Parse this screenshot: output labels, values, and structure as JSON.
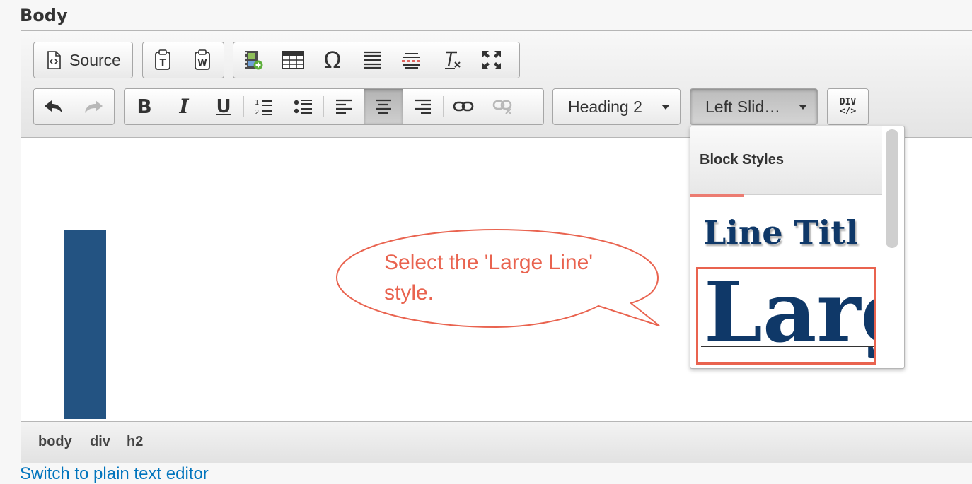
{
  "field_label": "Body",
  "toolbar": {
    "source_label": "Source",
    "format_combo": "Heading 2",
    "styles_combo": "Left Slid…",
    "div_label_top": "DIV",
    "div_label_bottom": "</>"
  },
  "icons": {
    "paste_text": "paste-text-icon",
    "paste_word": "paste-from-word-icon",
    "media": "insert-media-icon",
    "table": "table-icon",
    "special_char": "omega-icon",
    "hr": "horizontal-rule-icon",
    "page_break": "page-break-icon",
    "remove_format": "remove-format-icon",
    "maximize": "maximize-icon",
    "undo": "undo-icon",
    "redo": "redo-icon",
    "bold": "bold-icon",
    "italic": "italic-icon",
    "underline": "underline-icon",
    "ordered_list": "numbered-list-icon",
    "bullet_list": "bulleted-list-icon",
    "align_left": "align-left-icon",
    "align_center": "align-center-icon",
    "align_right": "align-right-icon",
    "link": "link-icon",
    "unlink": "unlink-icon"
  },
  "glyphs": {
    "bold": "B",
    "italic": "I",
    "underline": "U",
    "omega": "Ω",
    "undo": "↶",
    "redo": "↷"
  },
  "path": [
    "body",
    "div",
    "h2"
  ],
  "switch_link": "Switch to plain text editor",
  "callout_text": "Select the 'Large Line' style.",
  "dropdown": {
    "title": "Block Styles",
    "item1": "Line Titl",
    "item2": "Larg"
  },
  "colors": {
    "accent_blue": "#235382",
    "style_text": "#0f3868",
    "callout": "#e9634f",
    "link": "#0074bd"
  }
}
